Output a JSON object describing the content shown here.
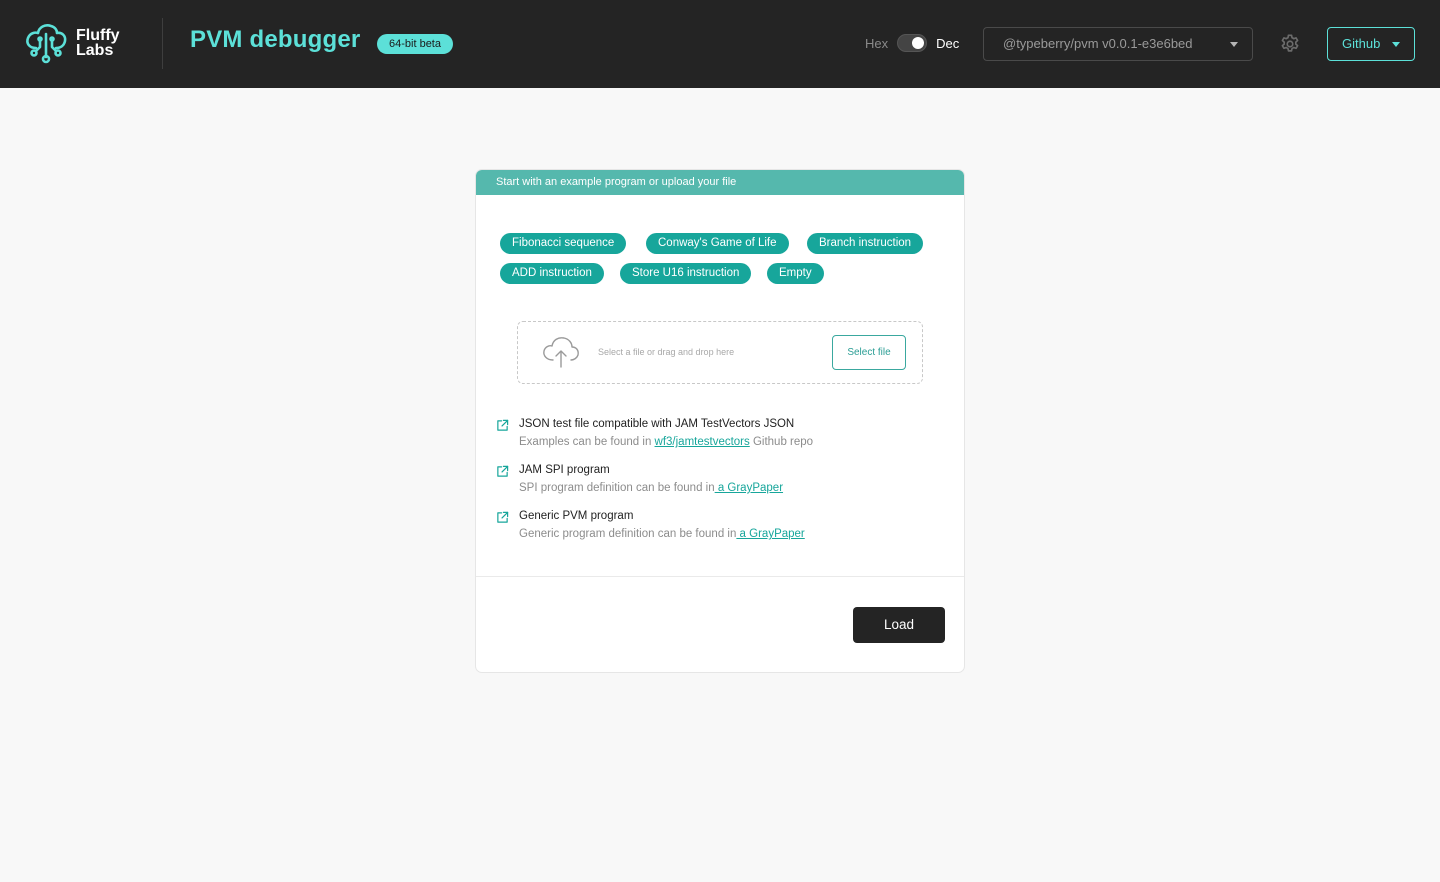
{
  "header": {
    "logo_line1": "Fluffy",
    "logo_line2": "Labs",
    "title": "PVM debugger",
    "badge": "64-bit beta",
    "toggle": {
      "left_label": "Hex",
      "right_label": "Dec",
      "selected": "Dec"
    },
    "version_select": {
      "value": "@typeberry/pvm v0.0.1-e3e6bed"
    },
    "github_label": "Github",
    "accent_color": "#5ce0d8"
  },
  "card": {
    "header_text": "Start with an example program or upload your file",
    "examples": [
      "Fibonacci sequence",
      "Conway's Game of Life",
      "Branch instruction",
      "ADD instruction",
      "Store U16 instruction",
      "Empty"
    ],
    "upload": {
      "prompt": "Select a file or drag and drop here",
      "button_label": "Select file"
    },
    "formats": [
      {
        "title": "JSON test file compatible with JAM TestVectors JSON",
        "desc_prefix": "Examples can be found in ",
        "link_text": "wf3/jamtestvectors",
        "desc_suffix": " Github repo"
      },
      {
        "title": "JAM SPI program",
        "desc_prefix": "SPI program definition can be found in",
        "link_text": " a GrayPaper",
        "desc_suffix": ""
      },
      {
        "title": "Generic PVM program",
        "desc_prefix": "Generic program definition can be found in",
        "link_text": " a GrayPaper ",
        "desc_suffix": ""
      }
    ],
    "load_label": "Load",
    "chip_color": "#17a69b"
  }
}
